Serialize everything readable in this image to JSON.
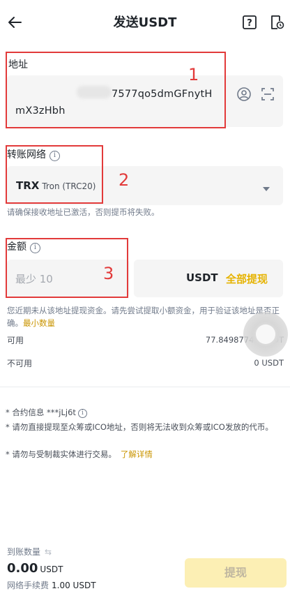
{
  "header": {
    "title": "发送USDT"
  },
  "address": {
    "label": "地址",
    "value_line1": "7577qo5dmGFnytH",
    "value_line2": "mX3zHbh"
  },
  "network": {
    "label": "转账网络",
    "code": "TRX",
    "name": "Tron (TRC20)",
    "hint": "请确保接收地址已激活，否则提币将失败。"
  },
  "amount": {
    "label": "金额",
    "placeholder": "最少 10",
    "unit": "USDT",
    "max_button": "全部提现",
    "hint": "您近期未从该地址提现资金。请先尝试提取小额资金，用于验证该地址是否正确。",
    "hint_link": "最小数量"
  },
  "balances": {
    "available_label": "可用",
    "available_value": "77.84987742 USDT",
    "unavailable_label": "不可用",
    "unavailable_value": "0 USDT"
  },
  "notes": [
    "* 合约信息 ***jLj6t",
    "* 请勿直接提现至众筹或ICO地址，否则将无法收到众筹或ICO发放的代币。",
    "* 请勿与受制裁实体进行交易。"
  ],
  "notes_link": "了解详情",
  "footer": {
    "receive_label": "到账数量",
    "receive_amount": "0.00",
    "receive_unit": "USDT",
    "fee_label": "网络手续费",
    "fee_value": "1.00 USDT",
    "submit_label": "提现"
  },
  "annotations": [
    "1",
    "2",
    "3"
  ],
  "colors": {
    "accent": "#e6b300",
    "link": "#c99400",
    "annotation_red": "#e23a3a",
    "submit_bg": "#fcefb4"
  }
}
